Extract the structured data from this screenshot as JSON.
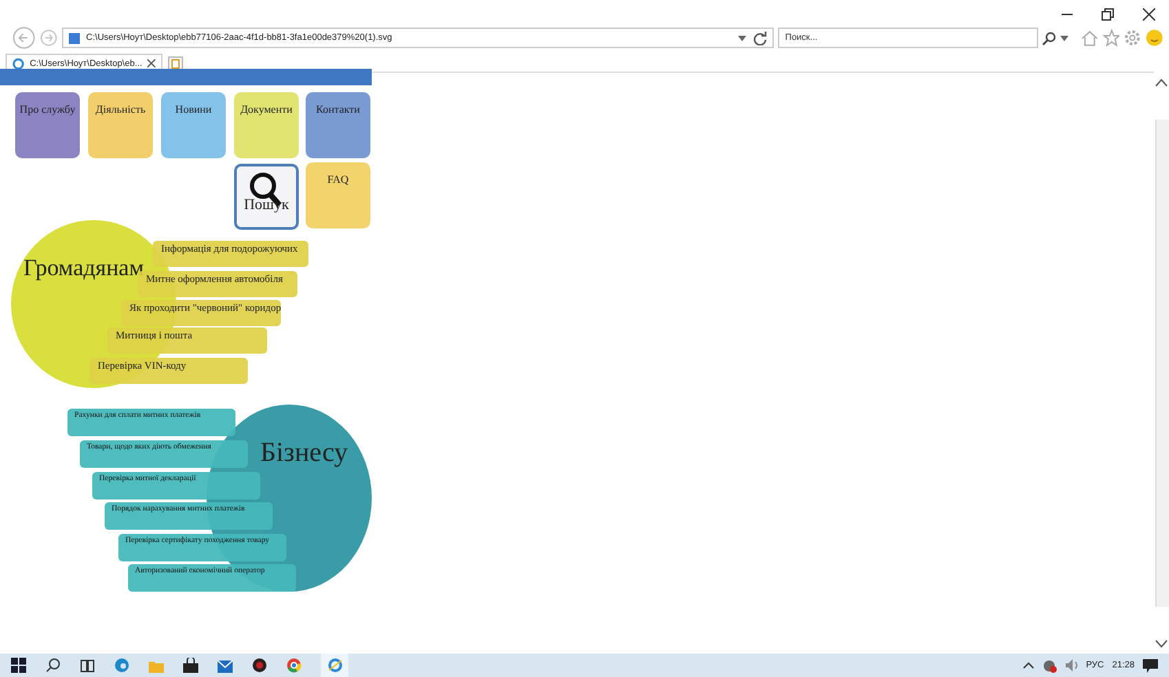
{
  "browser": {
    "address": "C:\\Users\\Ноут\\Desktop\\ebb77106-2aac-4f1d-bb81-3fa1e00de379%20(1).svg",
    "search_placeholder": "Поиск...",
    "tab_title": "C:\\Users\\Ноут\\Desktop\\eb..."
  },
  "nav_tiles": [
    {
      "kind": "tile",
      "label": "Про службу",
      "color": "#8a84c2"
    },
    {
      "kind": "tile",
      "label": "Діяльність",
      "color": "#f3cf6c"
    },
    {
      "kind": "tile",
      "label": "Новини",
      "color": "#84c2ea"
    },
    {
      "kind": "tile",
      "label": "Документи",
      "color": "#e2e472"
    },
    {
      "kind": "tile",
      "label": "Контакти",
      "color": "#7a9ad2"
    },
    {
      "kind": "search",
      "label": "Пошук",
      "color": "#f4f4f6"
    },
    {
      "kind": "tile",
      "label": "FAQ",
      "color": "#f3d46c"
    }
  ],
  "citizens": {
    "title": "Громадянам",
    "links": [
      "Інформація для подорожуючих",
      "Митне оформлення автомобіля",
      "Як проходити \"червоний\" коридор",
      "Митниця і пошта",
      "Перевірка VIN-коду"
    ]
  },
  "business": {
    "title": "Бізнесу",
    "links": [
      "Рахунки для сплати митних платежів",
      "Товари, щодо яких діють обмеження",
      "Перевірка митної декларації",
      "Порядок нарахування митних платежів",
      "Перевірка сертифікату походження товару",
      "Авторизований економічний оператор"
    ]
  },
  "taskbar": {
    "language": "РУС",
    "time": "21:28"
  }
}
